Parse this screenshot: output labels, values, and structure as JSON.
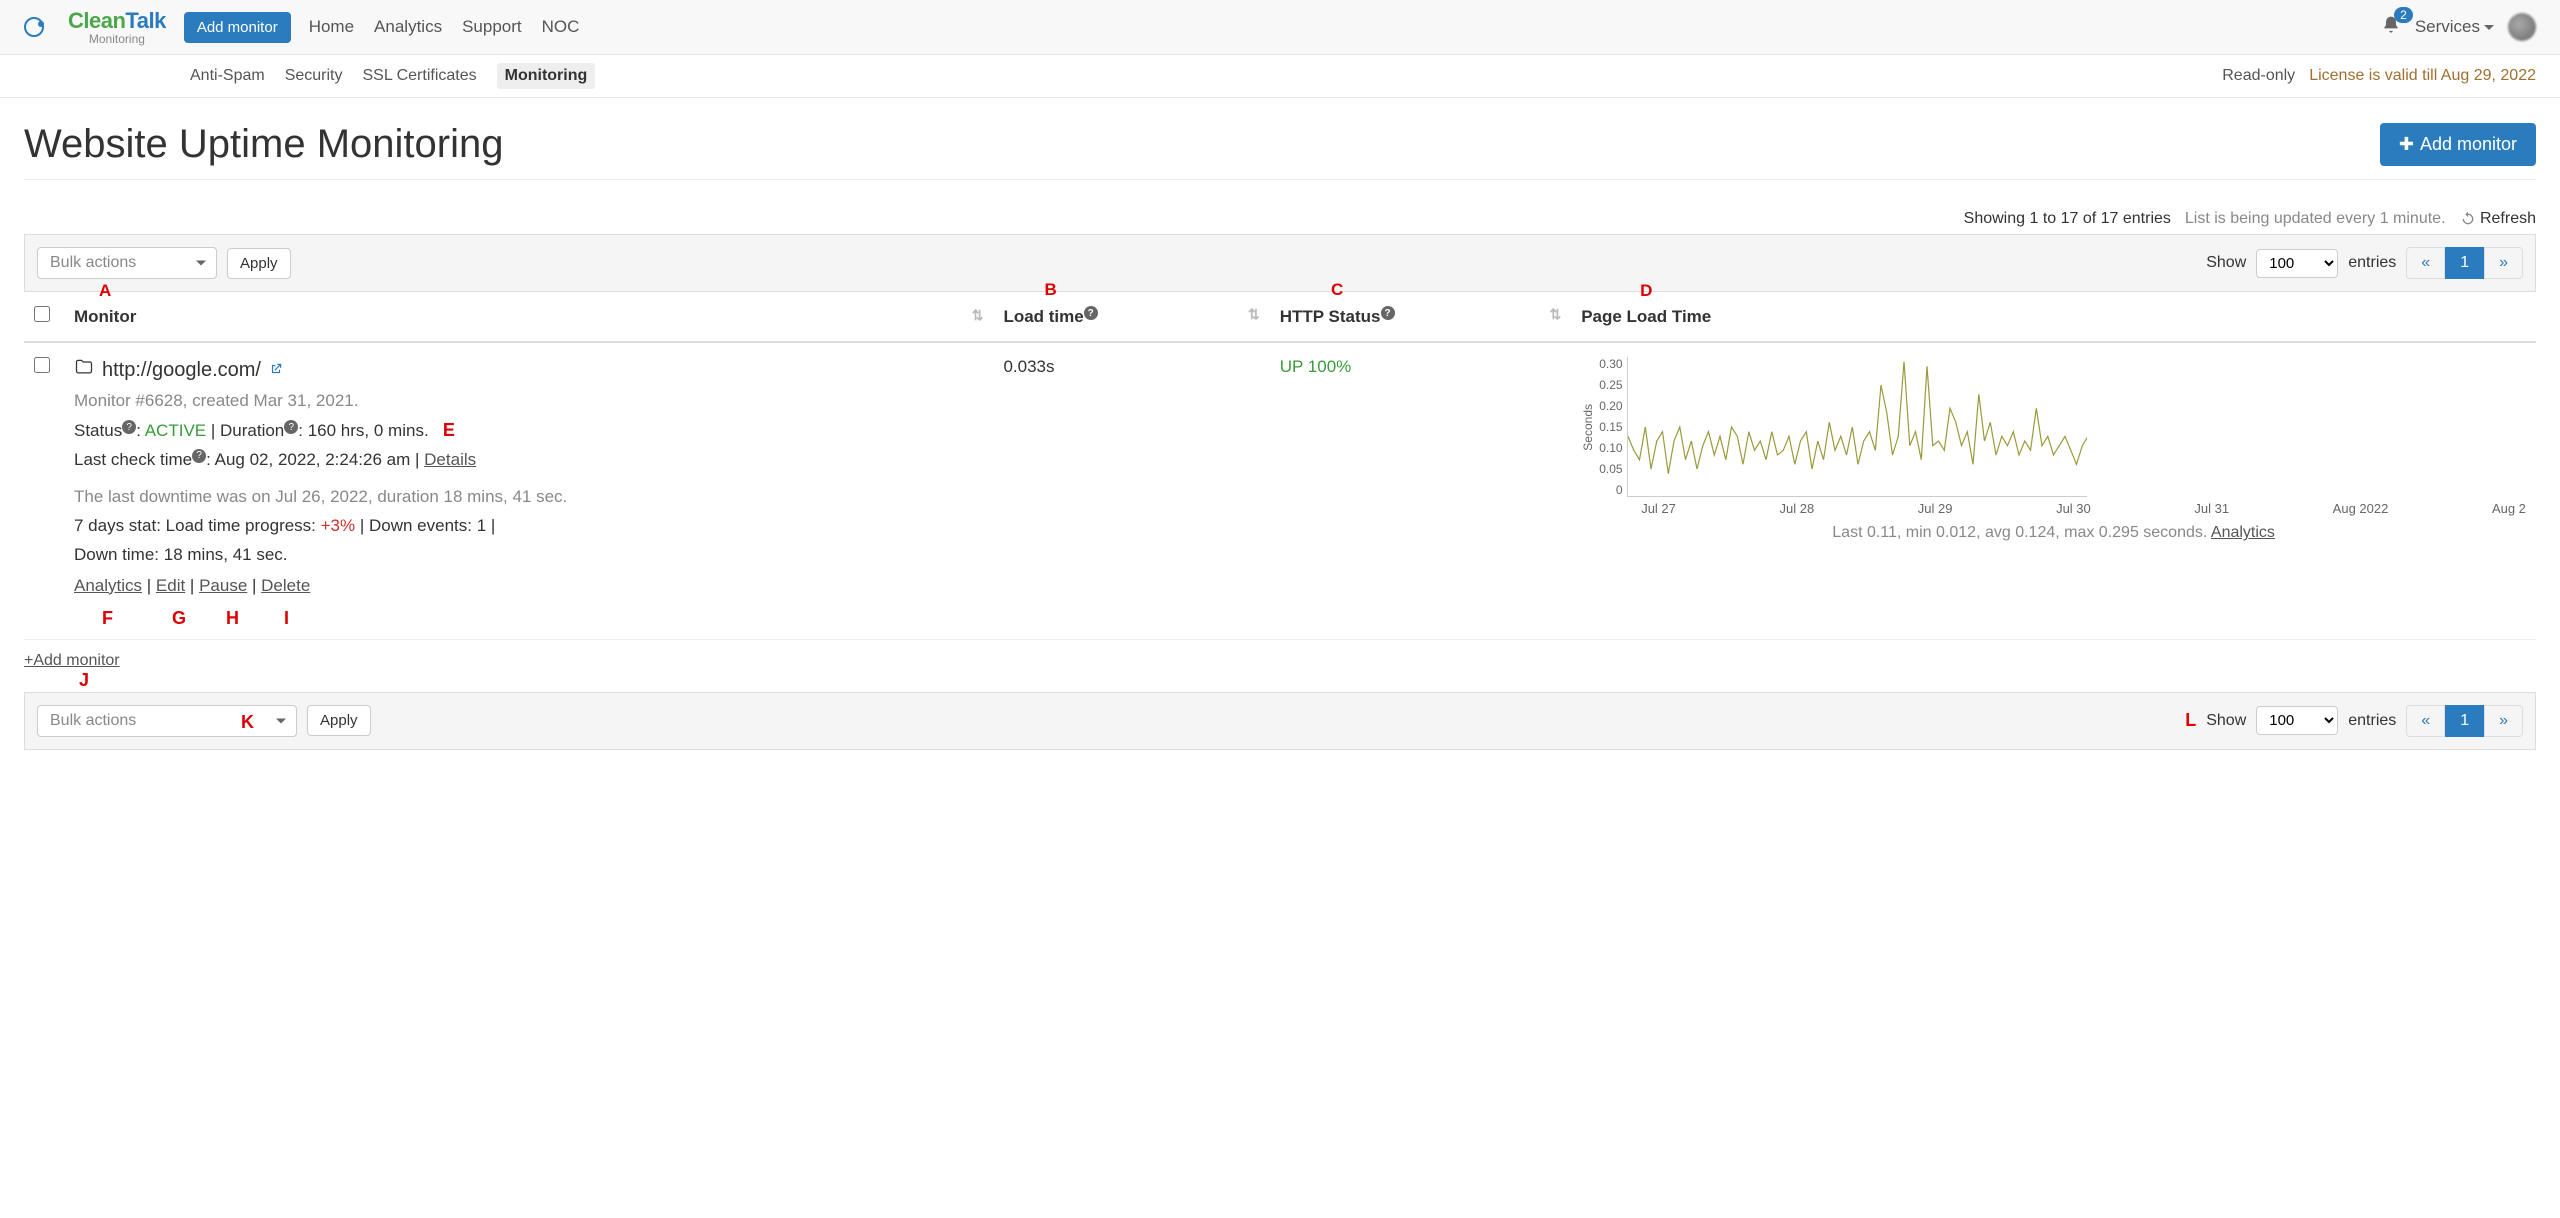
{
  "nav": {
    "logo_green": "Clean",
    "logo_blue": "Talk",
    "logo_sub": "Monitoring",
    "add_monitor_btn": "Add monitor",
    "links": [
      "Home",
      "Analytics",
      "Support",
      "NOC"
    ],
    "notif_count": "2",
    "services": "Services"
  },
  "subnav": {
    "tabs": [
      "Anti-Spam",
      "Security",
      "SSL Certificates",
      "Monitoring"
    ],
    "active_index": 3,
    "readonly": "Read-only",
    "license": "License is valid till Aug 29, 2022"
  },
  "page": {
    "title": "Website Uptime Monitoring",
    "add_monitor": "Add monitor",
    "showing": "Showing 1 to 17 of 17 entries",
    "updating": "List is being updated every 1 minute.",
    "refresh": "Refresh"
  },
  "toolbar": {
    "bulk": "Bulk actions",
    "apply": "Apply",
    "show": "Show",
    "entries": "entries",
    "page_size": "100",
    "prev": "«",
    "page": "1",
    "next": "»"
  },
  "columns": {
    "monitor": "Monitor",
    "load_time": "Load time",
    "http_status": "HTTP Status",
    "page_load": "Page Load Time"
  },
  "annots": {
    "A": "A",
    "B": "B",
    "C": "C",
    "D": "D",
    "E": "E",
    "F": "F",
    "G": "G",
    "H": "H",
    "I": "I",
    "J": "J",
    "K": "K",
    "L": "L"
  },
  "row": {
    "url": "http://google.com/",
    "load_time": "0.033s",
    "http_status": "UP 100%",
    "meta": "Monitor #6628, created Mar 31, 2021.",
    "status_label": "Status",
    "status_value": "ACTIVE",
    "duration_label": "Duration",
    "duration_value": "160 hrs, 0 mins.",
    "last_check_label": "Last check time",
    "last_check_value": "Aug 02, 2022, 2:24:26 am",
    "details": "Details",
    "downtime": "The last downtime was on Jul 26, 2022, duration 18 mins, 41 sec.",
    "seven_day_prefix": "7 days stat: Load time progress: ",
    "seven_day_progress": "+3%",
    "seven_day_suffix": " | Down events: 1 |",
    "down_time_line": "Down time: 18 mins, 41 sec.",
    "analytics": "Analytics",
    "edit": "Edit",
    "pause": "Pause",
    "delete": "Delete"
  },
  "add_link": "+Add monitor",
  "chart_data": {
    "type": "line",
    "ylabel": "Seconds",
    "ylim": [
      0,
      0.3
    ],
    "yticks": [
      "0.30",
      "0.25",
      "0.20",
      "0.15",
      "0.10",
      "0.05",
      "0"
    ],
    "x_labels": [
      "Jul 27",
      "Jul 28",
      "Jul 29",
      "Jul 30",
      "Jul 31",
      "Aug 2022",
      "Aug 2"
    ],
    "values": [
      0.13,
      0.1,
      0.08,
      0.15,
      0.06,
      0.12,
      0.14,
      0.05,
      0.12,
      0.15,
      0.08,
      0.12,
      0.06,
      0.11,
      0.14,
      0.09,
      0.13,
      0.08,
      0.15,
      0.13,
      0.07,
      0.14,
      0.1,
      0.12,
      0.08,
      0.14,
      0.09,
      0.1,
      0.13,
      0.07,
      0.12,
      0.14,
      0.06,
      0.12,
      0.08,
      0.16,
      0.1,
      0.13,
      0.09,
      0.15,
      0.07,
      0.12,
      0.14,
      0.1,
      0.24,
      0.18,
      0.09,
      0.13,
      0.29,
      0.11,
      0.14,
      0.08,
      0.28,
      0.11,
      0.12,
      0.1,
      0.19,
      0.16,
      0.11,
      0.14,
      0.07,
      0.22,
      0.12,
      0.16,
      0.09,
      0.13,
      0.11,
      0.14,
      0.09,
      0.12,
      0.1,
      0.19,
      0.11,
      0.13,
      0.09,
      0.11,
      0.13,
      0.1,
      0.07,
      0.11,
      0.13
    ],
    "caption_prefix": "Last 0.11, min 0.012, avg 0.124, max 0.295 seconds. ",
    "caption_link": "Analytics"
  }
}
